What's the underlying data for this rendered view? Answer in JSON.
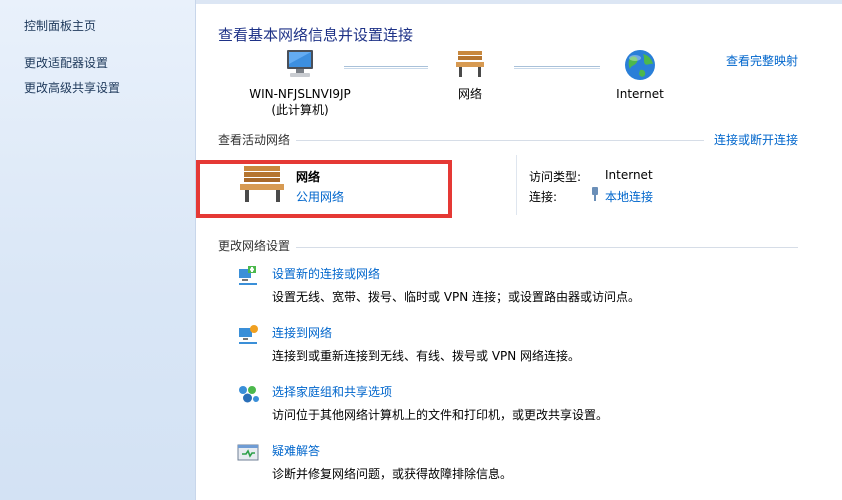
{
  "sidebar": {
    "home": "控制面板主页",
    "links": [
      "更改适配器设置",
      "更改高级共享设置"
    ]
  },
  "main": {
    "title": "查看基本网络信息并设置连接",
    "full_map": "查看完整映射",
    "map": {
      "computer_name": "WIN-NFJSLNVI9JP",
      "computer_sub": "(此计算机)",
      "network": "网络",
      "internet": "Internet"
    },
    "active": {
      "heading": "查看活动网络",
      "connect_link": "连接或断开连接",
      "network_name": "网络",
      "network_type": "公用网络",
      "access_type_label": "访问类型:",
      "access_type_value": "Internet",
      "connection_label": "连接:",
      "connection_value": "本地连接"
    },
    "change": {
      "heading": "更改网络设置",
      "tasks": [
        {
          "title": "设置新的连接或网络",
          "desc": "设置无线、宽带、拨号、临时或 VPN 连接；或设置路由器或访问点。",
          "icon": "new-connection-icon"
        },
        {
          "title": "连接到网络",
          "desc": "连接到或重新连接到无线、有线、拨号或 VPN 网络连接。",
          "icon": "connect-network-icon"
        },
        {
          "title": "选择家庭组和共享选项",
          "desc": "访问位于其他网络计算机上的文件和打印机，或更改共享设置。",
          "icon": "homegroup-icon"
        },
        {
          "title": "疑难解答",
          "desc": "诊断并修复网络问题，或获得故障排除信息。",
          "icon": "troubleshoot-icon"
        }
      ]
    }
  },
  "colors": {
    "link": "#0066cc",
    "title": "#1e3287",
    "highlight": "#e53935"
  }
}
